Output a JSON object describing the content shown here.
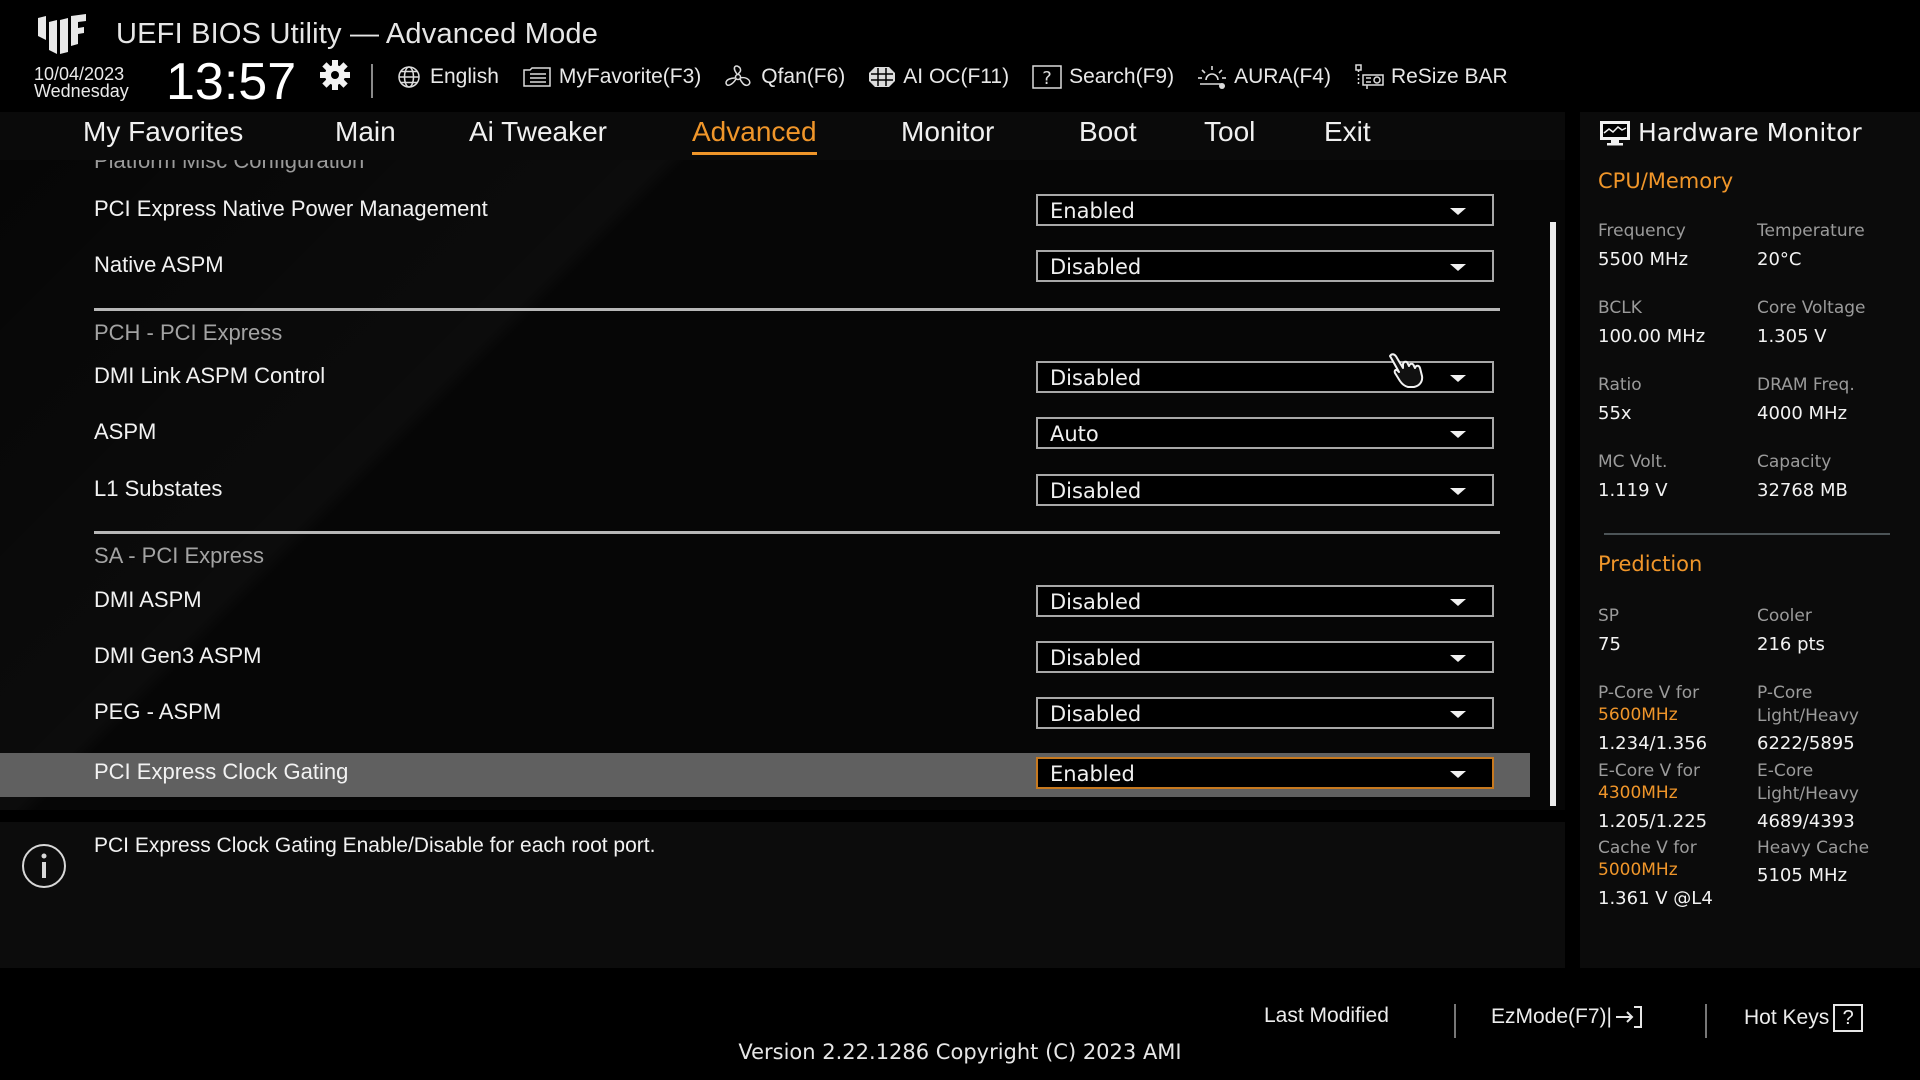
{
  "header": {
    "title": "UEFI BIOS Utility — Advanced Mode",
    "date": "10/04/2023",
    "day": "Wednesday",
    "time": "13:57",
    "toolbar": [
      {
        "icon": "globe-icon",
        "label": "English"
      },
      {
        "icon": "favorite-list-icon",
        "label": "MyFavorite(F3)"
      },
      {
        "icon": "fan-icon",
        "label": "Qfan(F6)"
      },
      {
        "icon": "ai-oc-icon",
        "label": "AI OC(F11)"
      },
      {
        "icon": "search-help-icon",
        "label": "Search(F9)"
      },
      {
        "icon": "aura-light-icon",
        "label": "AURA(F4)"
      },
      {
        "icon": "resize-bar-icon",
        "label": "ReSize BAR"
      }
    ]
  },
  "nav": {
    "tabs": [
      "My Favorites",
      "Main",
      "Ai Tweaker",
      "Advanced",
      "Monitor",
      "Boot",
      "Tool",
      "Exit"
    ],
    "active": "Advanced"
  },
  "settings": {
    "cut_heading": "Platform Misc Configuration",
    "group1": [
      {
        "label": "PCI Express Native Power Management",
        "value": "Enabled"
      },
      {
        "label": "Native ASPM",
        "value": "Disabled"
      }
    ],
    "pch_heading": "PCH - PCI Express",
    "group2": [
      {
        "label": "DMI Link ASPM Control",
        "value": "Disabled"
      },
      {
        "label": "ASPM",
        "value": "Auto"
      },
      {
        "label": "L1 Substates",
        "value": "Disabled"
      }
    ],
    "sa_heading": "SA - PCI Express",
    "group3": [
      {
        "label": "DMI ASPM",
        "value": "Disabled"
      },
      {
        "label": "DMI Gen3 ASPM",
        "value": "Disabled"
      },
      {
        "label": "PEG - ASPM",
        "value": "Disabled"
      },
      {
        "label": "PCI Express Clock Gating",
        "value": "Enabled",
        "selected": true
      }
    ]
  },
  "info": {
    "text": "PCI Express Clock Gating Enable/Disable for each root port."
  },
  "hardware_monitor": {
    "title": "Hardware Monitor",
    "cpu_memory": {
      "heading": "CPU/Memory",
      "items": [
        {
          "label": "Frequency",
          "value": "5500 MHz"
        },
        {
          "label": "Temperature",
          "value": "20°C"
        },
        {
          "label": "BCLK",
          "value": "100.00 MHz"
        },
        {
          "label": "Core Voltage",
          "value": "1.305 V"
        },
        {
          "label": "Ratio",
          "value": "55x"
        },
        {
          "label": "DRAM Freq.",
          "value": "4000 MHz"
        },
        {
          "label": "MC Volt.",
          "value": "1.119 V"
        },
        {
          "label": "Capacity",
          "value": "32768 MB"
        }
      ]
    },
    "prediction": {
      "heading": "Prediction",
      "sp_label": "SP",
      "sp_value": "75",
      "cooler_label": "Cooler",
      "cooler_value": "216 pts",
      "pcore_v_label": "P-Core V for",
      "pcore_v_freq": "5600MHz",
      "pcore_v_value": "1.234/1.356",
      "pcore_lh_label1": "P-Core",
      "pcore_lh_label2": "Light/Heavy",
      "pcore_lh_value": "6222/5895",
      "ecore_v_label": "E-Core V for",
      "ecore_v_freq": "4300MHz",
      "ecore_v_value": "1.205/1.225",
      "ecore_lh_label1": "E-Core",
      "ecore_lh_label2": "Light/Heavy",
      "ecore_lh_value": "4689/4393",
      "cache_v_label": "Cache V for",
      "cache_v_freq": "5000MHz",
      "cache_v_value": "1.361 V @L4",
      "heavy_cache_label": "Heavy Cache",
      "heavy_cache_value": "5105 MHz"
    }
  },
  "footer": {
    "last_modified": "Last Modified",
    "ezmode": "EzMode(F7)|",
    "hotkeys": "Hot Keys",
    "hotkeys_glyph": "?",
    "version": "Version 2.22.1286 Copyright (C) 2023 AMI"
  },
  "colors": {
    "accent": "#f0962a",
    "selected_row": "#606060",
    "background": "#000000"
  }
}
